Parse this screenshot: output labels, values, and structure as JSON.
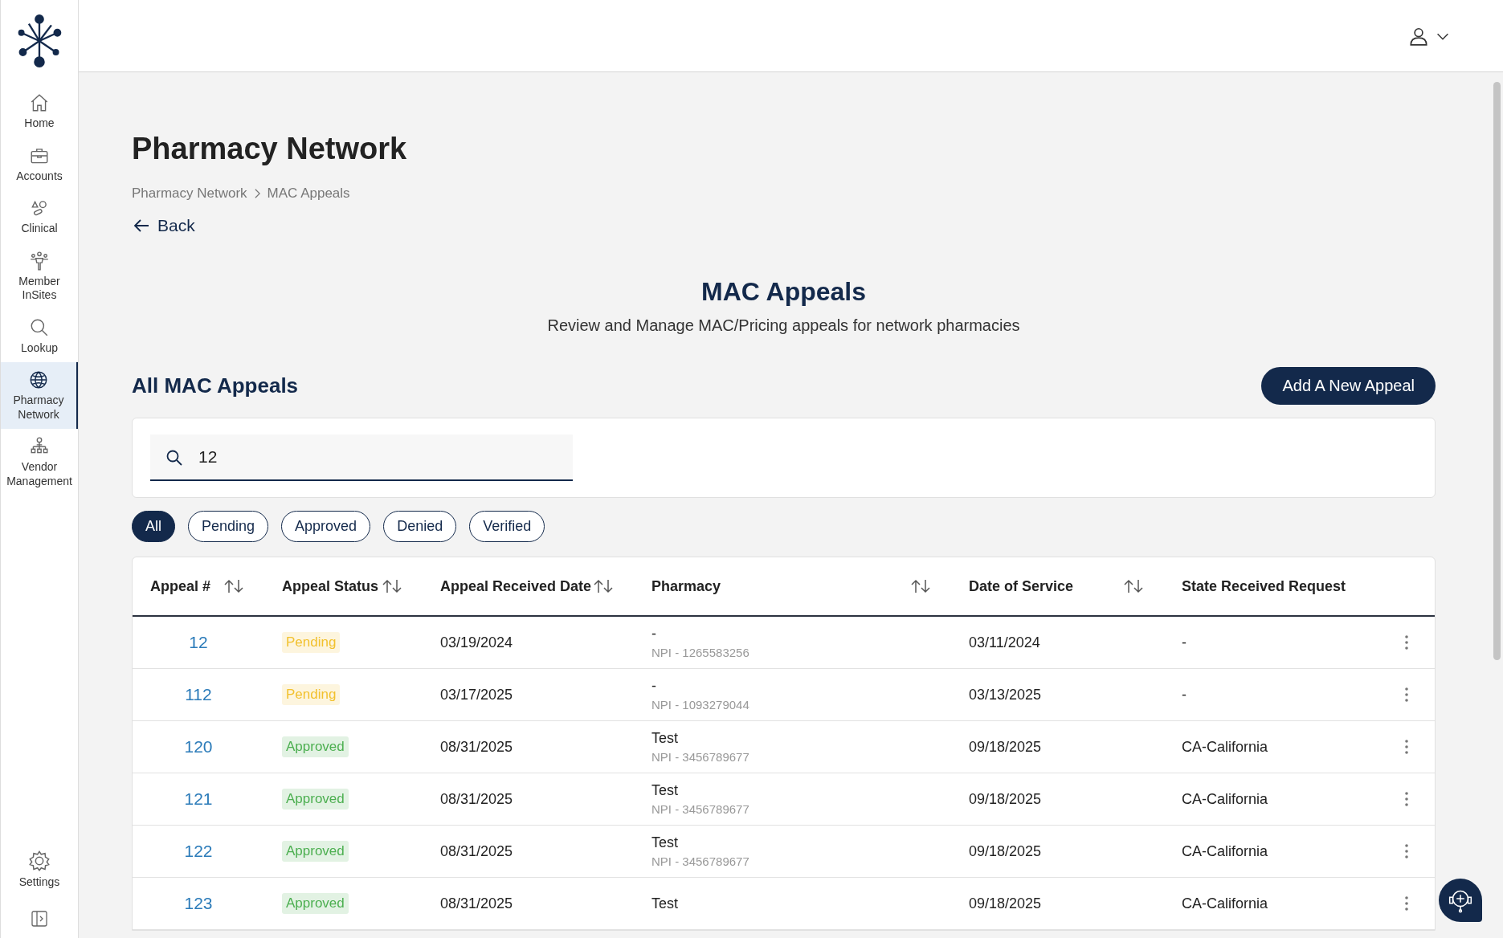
{
  "sidebar": {
    "items": [
      {
        "label": "Home",
        "selected": false
      },
      {
        "label": "Accounts",
        "selected": false
      },
      {
        "label": "Clinical",
        "selected": false
      },
      {
        "label": "Member InSites",
        "selected": false
      },
      {
        "label": "Lookup",
        "selected": false
      },
      {
        "label": "Pharmacy Network",
        "selected": true
      },
      {
        "label": "Vendor Management",
        "selected": false
      }
    ],
    "settings": "Settings"
  },
  "page_title": "Pharmacy Network",
  "breadcrumb": [
    "Pharmacy Network",
    "MAC Appeals"
  ],
  "back": "Back",
  "heading": "MAC Appeals",
  "subheading": "Review and Manage MAC/Pricing appeals for network pharmacies",
  "section_title": "All MAC Appeals",
  "add_button": "Add A New Appeal",
  "search": {
    "value": "12"
  },
  "filters": [
    {
      "label": "All",
      "selected": true
    },
    {
      "label": "Pending",
      "selected": false
    },
    {
      "label": "Approved",
      "selected": false
    },
    {
      "label": "Denied",
      "selected": false
    },
    {
      "label": "Verified",
      "selected": false
    }
  ],
  "table": {
    "columns": [
      {
        "label": "Appeal #",
        "sortable": true
      },
      {
        "label": "Appeal Status",
        "sortable": true
      },
      {
        "label": "Appeal Received Date",
        "sortable": true
      },
      {
        "label": "Pharmacy",
        "sortable": true
      },
      {
        "label": "Date of Service",
        "sortable": true
      },
      {
        "label": "State Received Request",
        "sortable": false
      }
    ],
    "rows": [
      {
        "appeal": "12",
        "status": {
          "label": "Pending",
          "color": "#f2c12e"
        },
        "received": "03/19/2024",
        "pharmacy": "-",
        "npi": "NPI - 1265583256",
        "service": "03/11/2024",
        "state": "-"
      },
      {
        "appeal": "112",
        "status": {
          "label": "Pending",
          "color": "#f2c12e"
        },
        "received": "03/17/2025",
        "pharmacy": "-",
        "npi": "NPI - 1093279044",
        "service": "03/13/2025",
        "state": "-"
      },
      {
        "appeal": "120",
        "status": {
          "label": "Approved",
          "color": "#4caf50"
        },
        "received": "08/31/2025",
        "pharmacy": "Test",
        "npi": "NPI - 3456789677",
        "service": "09/18/2025",
        "state": "CA-California"
      },
      {
        "appeal": "121",
        "status": {
          "label": "Approved",
          "color": "#4caf50"
        },
        "received": "08/31/2025",
        "pharmacy": "Test",
        "npi": "NPI - 3456789677",
        "service": "09/18/2025",
        "state": "CA-California"
      },
      {
        "appeal": "122",
        "status": {
          "label": "Approved",
          "color": "#4caf50"
        },
        "received": "08/31/2025",
        "pharmacy": "Test",
        "npi": "NPI - 3456789677",
        "service": "09/18/2025",
        "state": "CA-California"
      },
      {
        "appeal": "123",
        "status": {
          "label": "Approved",
          "color": "#4caf50"
        },
        "received": "08/31/2025",
        "pharmacy": "Test",
        "service": "09/18/2025",
        "state": "CA-California"
      }
    ]
  }
}
